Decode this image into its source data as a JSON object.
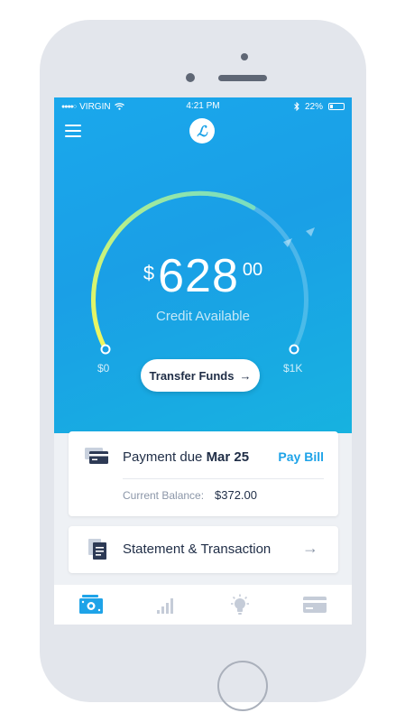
{
  "status_bar": {
    "carrier": "VIRGIN",
    "time": "4:21 PM",
    "battery": "22%"
  },
  "header": {
    "logo_letter": "ℒ"
  },
  "credit": {
    "currency": "$",
    "amount": "628",
    "cents": "00",
    "label": "Credit Available",
    "range_min": "$0",
    "range_max": "$1K",
    "fill_fraction": 0.628
  },
  "transfer_button": {
    "label": "Transfer Funds",
    "arrow": "→"
  },
  "payment": {
    "title_prefix": "Payment due",
    "due_date": "Mar 25",
    "action_label": "Pay Bill",
    "balance_label": "Current Balance:",
    "balance_value": "$372.00"
  },
  "statement": {
    "label": "Statement & Transaction",
    "arrow": "→"
  },
  "tabbar": {
    "items": [
      "cash-icon",
      "chart-bars-icon",
      "lightbulb-icon",
      "card-icon"
    ],
    "active_color": "#1ea3e8",
    "inactive_color": "#c5ccd8"
  },
  "colors": {
    "accent": "#1ea3e8",
    "gauge_start": "#f4f75a",
    "gauge_end": "#5fd6d6"
  }
}
